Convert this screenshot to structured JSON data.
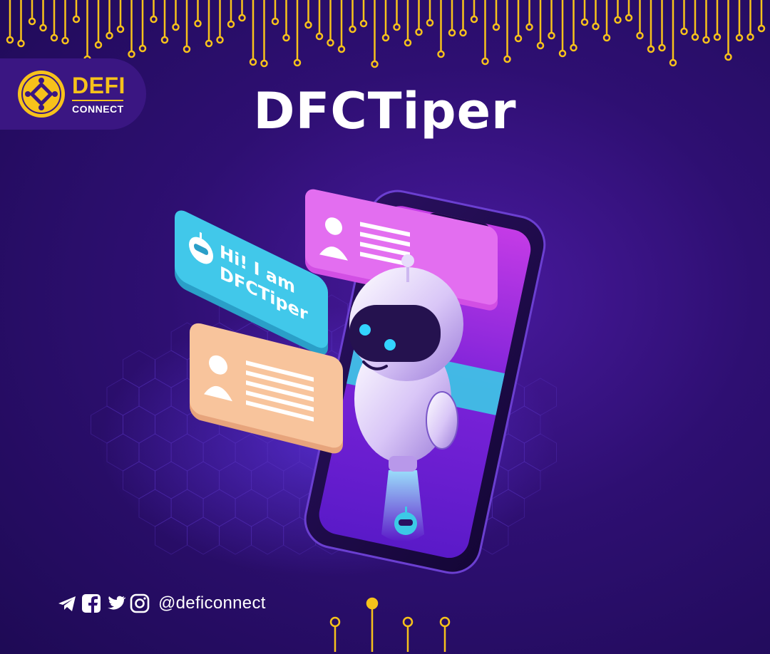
{
  "title": "DFCTiper",
  "logo": {
    "word": "DEFI",
    "sub": "CONNECT"
  },
  "bubble": {
    "line1": "Hi! I am",
    "line2": "DFCTiper"
  },
  "social": {
    "handle": "@deficonnect",
    "icons": [
      "telegram-icon",
      "facebook-icon",
      "twitter-icon",
      "instagram-icon"
    ]
  },
  "colors": {
    "background": "#2e0f72",
    "accent": "#f7c21b",
    "cyan": "#3ec6e8",
    "magenta": "#d655e6",
    "peach": "#f8c49c"
  }
}
